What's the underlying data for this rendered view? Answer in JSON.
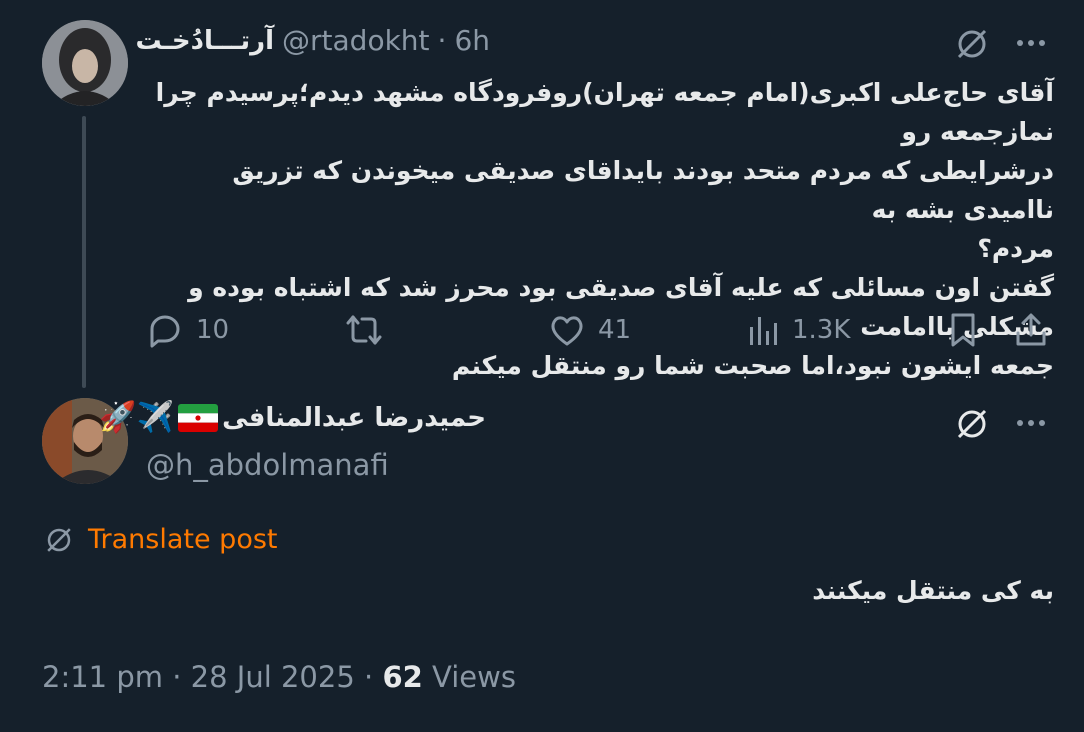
{
  "tweet1": {
    "display_name": "آرتـــادُخـت",
    "handle": "@rtadokht",
    "separator": "·",
    "time": "6h",
    "text_lines": [
      "آقای حاج‌علی اکبری(امام جمعه تهران)روفرودگاه مشهد دیدم؛پرسیدم چرا نمازجمعه رو",
      "درشرایطی که مردم متحد بودند بایداقای صدیقی میخوندن که تزریق ناامیدی بشه به",
      "مردم؟",
      "گفتن اون مسائلی که علیه آقای صدیقی بود محرز شد که اشتباه بوده و مشکلی باامامت",
      "جمعه ایشون نبود،اما صحبت شما رو منتقل میکنم"
    ],
    "replies": "10",
    "likes": "41",
    "views": "1.3K"
  },
  "tweet2": {
    "display_name": "حمیدرضا عبدالمنافی",
    "emoji": "🚀✈️",
    "handle": "@h_abdolmanafi",
    "translate_label": "Translate post",
    "text": "به کی منتقل میکنند",
    "time": "2:11 pm",
    "sep1": "·",
    "date": "28 Jul 2025",
    "sep2": "·",
    "views_count": "62",
    "views_label": "Views"
  },
  "icons": {
    "grok": "grok-icon",
    "more": "more-icon",
    "reply": "reply-icon",
    "retweet": "retweet-icon",
    "like": "like-icon",
    "views": "views-icon",
    "bookmark": "bookmark-icon",
    "share": "share-icon"
  },
  "colors": {
    "background": "#15202b",
    "text": "#e7e9ea",
    "muted": "#8b98a5",
    "translate": "#ff7a00"
  }
}
